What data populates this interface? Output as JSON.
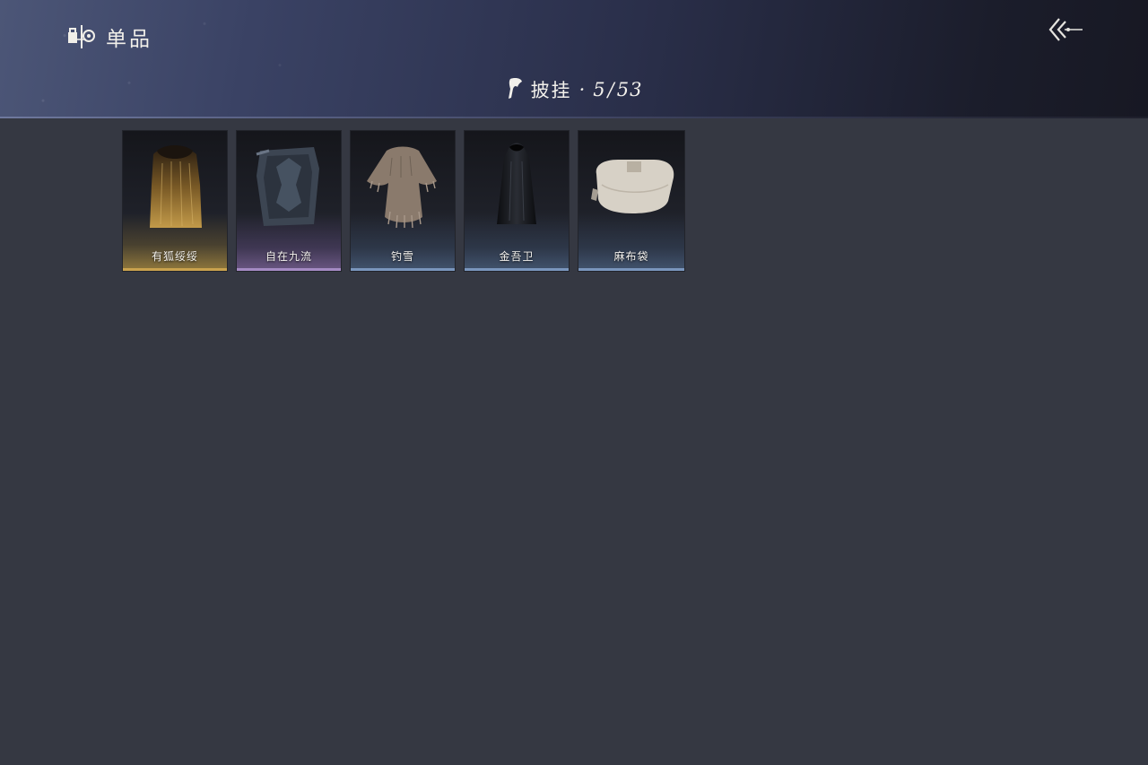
{
  "header": {
    "section_icon": "collection-icon",
    "section_title": "单品",
    "back_icon": "back-arrow-icon",
    "category_icon": "cape-icon",
    "category_name": "披挂",
    "category_separator": "·",
    "collected": "5",
    "slash": "/",
    "total": "53"
  },
  "items": [
    {
      "name": "有狐绥绥",
      "rarity": "gold",
      "icon": "golden-fur-cloak-icon"
    },
    {
      "name": "自在九流",
      "rarity": "purple",
      "icon": "embroidered-cape-icon"
    },
    {
      "name": "钓雪",
      "rarity": "blue",
      "icon": "straw-raincoat-icon"
    },
    {
      "name": "金吾卫",
      "rarity": "blue",
      "icon": "black-hooded-cloak-icon"
    },
    {
      "name": "麻布袋",
      "rarity": "blue",
      "icon": "linen-sack-icon"
    }
  ],
  "colors": {
    "background": "#353842",
    "gold": "#c9a24e",
    "purple": "#a58bc4",
    "blue": "#7a96bd"
  }
}
